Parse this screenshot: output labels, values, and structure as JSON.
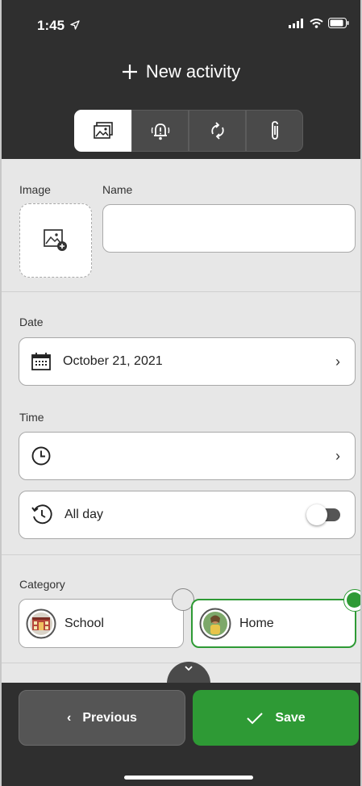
{
  "status": {
    "time": "1:45",
    "location_icon": "location-arrow-icon"
  },
  "header": {
    "title": "New activity",
    "add_icon": "plus-icon"
  },
  "tabs": [
    {
      "name": "image-tab",
      "icon": "image-icon",
      "selected": true
    },
    {
      "name": "alarm-tab",
      "icon": "alarm-bell-icon",
      "selected": false
    },
    {
      "name": "repeat-tab",
      "icon": "repeat-icon",
      "selected": false
    },
    {
      "name": "attachment-tab",
      "icon": "paperclip-icon",
      "selected": false
    }
  ],
  "form": {
    "image_label": "Image",
    "name_label": "Name",
    "name_value": "",
    "date_label": "Date",
    "date_value": "October 21, 2021",
    "time_label": "Time",
    "time_value": "",
    "allday_label": "All day",
    "allday_on": false,
    "category_label": "Category"
  },
  "categories": [
    {
      "name": "School",
      "selected": false
    },
    {
      "name": "Home",
      "selected": true
    }
  ],
  "colors": {
    "accent": "#2e9a35",
    "header_bg": "#2f2f2f",
    "body_bg": "#e7e7e7"
  },
  "actions": {
    "previous_label": "Previous",
    "save_label": "Save"
  }
}
